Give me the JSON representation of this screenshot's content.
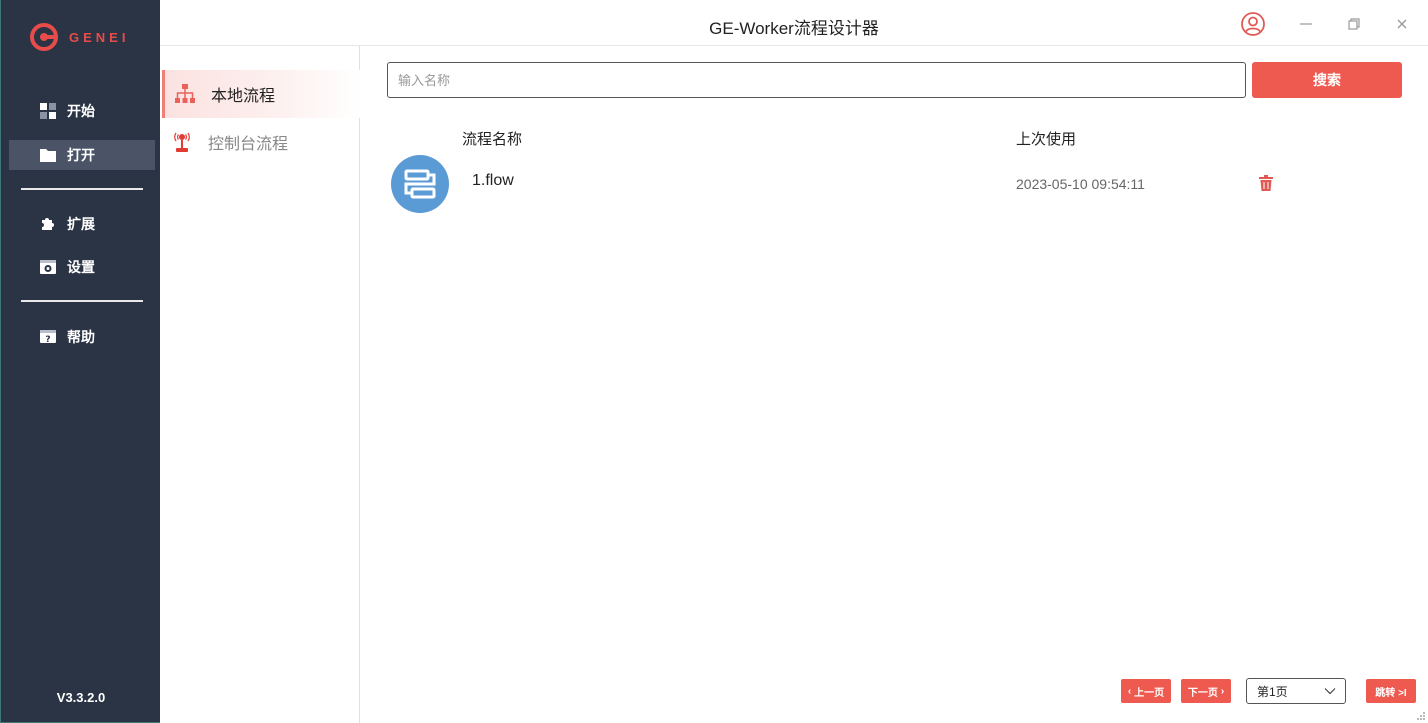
{
  "app": {
    "title": "GE-Worker流程设计器",
    "logo_text": "GENEI",
    "version": "V3.3.2.0",
    "accent": "#ef5a50",
    "nav_bg": "#2b3444"
  },
  "nav": {
    "items": [
      {
        "label": "开始",
        "icon": "dashboard-icon"
      },
      {
        "label": "打开",
        "icon": "folder-icon",
        "active": true
      },
      {
        "label": "扩展",
        "icon": "puzzle-icon"
      },
      {
        "label": "设置",
        "icon": "settings-icon"
      },
      {
        "label": "帮助",
        "icon": "help-icon"
      }
    ]
  },
  "subnav": {
    "items": [
      {
        "label": "本地流程",
        "icon": "sitemap-icon",
        "active": true
      },
      {
        "label": "控制台流程",
        "icon": "broadcast-icon",
        "active": false
      }
    ]
  },
  "search": {
    "placeholder": "输入名称",
    "value": "",
    "button_label": "搜索"
  },
  "table": {
    "headers": {
      "name": "流程名称",
      "last_used": "上次使用"
    },
    "rows": [
      {
        "name": "1.flow",
        "last_used": "2023-05-10 09:54:11",
        "icon": "flow-icon"
      }
    ]
  },
  "pagination": {
    "prev_label": "上一页",
    "next_label": "下一页",
    "page_label": "第1页",
    "jump_label": "跳转 >I"
  }
}
